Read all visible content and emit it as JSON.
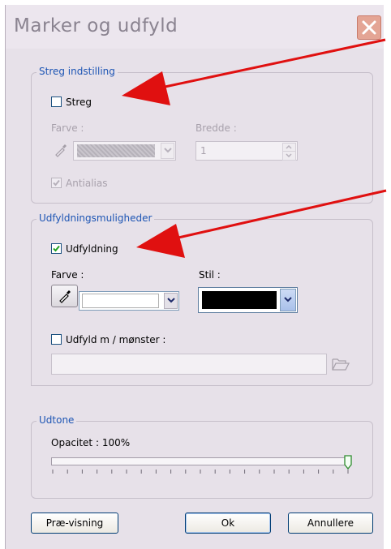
{
  "window": {
    "title": "Marker og udfyld"
  },
  "stroke": {
    "legend": "Streg indstilling",
    "enable_label": "Streg",
    "enabled": false,
    "color_label": "Farve :",
    "width_label": "Bredde :",
    "width_value": "1",
    "antialias_label": "Antialias",
    "antialias_checked": true
  },
  "fill": {
    "legend": "Udfyldningsmuligheder",
    "enable_label": "Udfyldning",
    "enabled": true,
    "color_label": "Farve :",
    "style_label": "Stil :",
    "style_swatch_color": "#000000",
    "pattern_label": "Udfyld m / mønster :",
    "pattern_enabled": false,
    "pattern_value": ""
  },
  "fade": {
    "legend": "Udtone",
    "opacity_label": "Opacitet : 100%",
    "opacity_percent": 100
  },
  "buttons": {
    "preview": "Præ-visning",
    "ok": "Ok",
    "cancel": "Annullere"
  },
  "annotations": {
    "arrow_color": "#e01010"
  }
}
